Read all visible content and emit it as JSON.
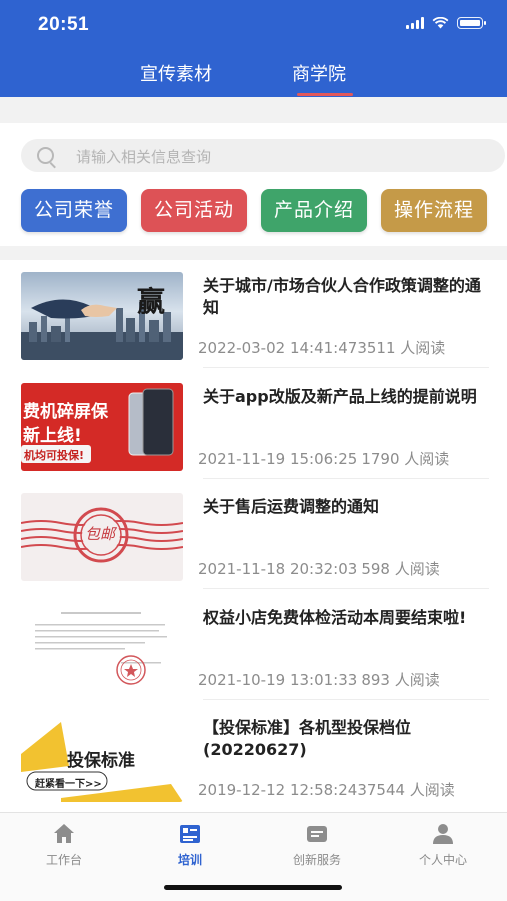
{
  "status": {
    "time": "20:51"
  },
  "tabs": [
    {
      "label": "宣传素材"
    },
    {
      "label": "商学院"
    }
  ],
  "search": {
    "placeholder": "请输入相关信息查询"
  },
  "categories": [
    {
      "label": "公司荣誉"
    },
    {
      "label": "公司活动"
    },
    {
      "label": "产品介绍"
    },
    {
      "label": "操作流程"
    }
  ],
  "articles": [
    {
      "title": "关于城市/市场合伙人合作政策调整的通知",
      "date": "2022-03-02 14:41:47",
      "views": "3511 人阅读",
      "thumb_text": "赢"
    },
    {
      "title": "关于app改版及新产品上线的提前说明",
      "date": "2021-11-19 15:06:25",
      "views": "1790 人阅读",
      "thumb_text": [
        "费机碎屏保",
        "新上线!",
        "机均可投保!"
      ]
    },
    {
      "title": "关于售后运费调整的通知",
      "date": "2021-11-18 20:32:03",
      "views": "598 人阅读",
      "thumb_text": "包邮"
    },
    {
      "title": "权益小店免费体检活动本周要结束啦!",
      "date": "2021-10-19 13:01:33",
      "views": "893 人阅读"
    },
    {
      "title": "【投保标准】各机型投保档位(20220627)",
      "date": "2019-12-12 12:58:24",
      "views": "37544 人阅读",
      "thumb_text": [
        "投保标准",
        "赶紧看一下>>"
      ]
    }
  ],
  "nav": [
    {
      "label": "工作台",
      "icon": "home-icon"
    },
    {
      "label": "培训",
      "icon": "training-icon"
    },
    {
      "label": "创新服务",
      "icon": "service-icon"
    },
    {
      "label": "个人中心",
      "icon": "person-icon"
    }
  ],
  "colors": {
    "primary": "#2f63d0",
    "accent": "#e2585a",
    "cat_blue": "#3e6fd1",
    "cat_red": "#dd5256",
    "cat_green": "#3fa46a",
    "cat_gold": "#c59a48"
  }
}
